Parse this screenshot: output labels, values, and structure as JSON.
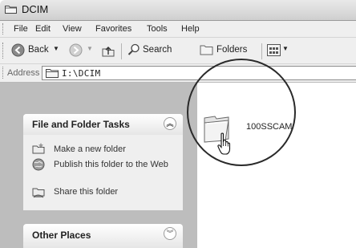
{
  "window": {
    "title": "DCIM"
  },
  "menu": {
    "items": [
      "File",
      "Edit",
      "View",
      "Favorites",
      "Tools",
      "Help"
    ]
  },
  "toolbar": {
    "back_label": "Back",
    "search_label": "Search",
    "folders_label": "Folders"
  },
  "address": {
    "label": "Address",
    "value": "I:\\DCIM"
  },
  "tasks_panel": {
    "title": "File and Folder Tasks",
    "items": [
      {
        "label": "Make a new folder",
        "icon": "new-folder-icon"
      },
      {
        "label": "Publish this folder to the Web",
        "icon": "globe-icon"
      },
      {
        "label": "Share this folder",
        "icon": "share-folder-icon"
      }
    ]
  },
  "other_places": {
    "title": "Other Places"
  },
  "content": {
    "folder_name": "100SSCAM"
  }
}
